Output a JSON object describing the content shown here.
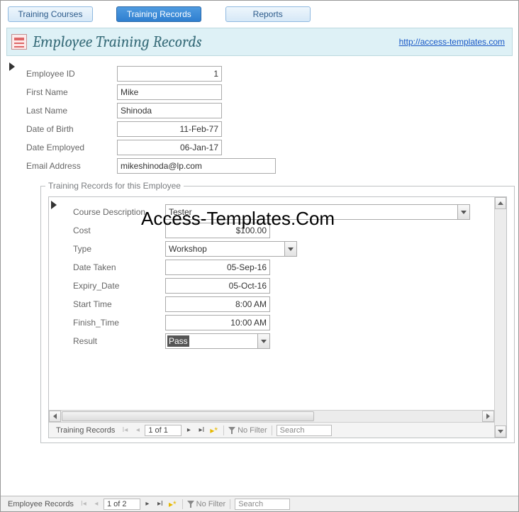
{
  "tabs": {
    "courses": "Training Courses",
    "records": "Training Records",
    "reports": "Reports"
  },
  "header": {
    "title": "Employee Training Records",
    "link": "http://access-templates.com"
  },
  "labels": {
    "emp_id": "Employee ID",
    "first_name": "First Name",
    "last_name": "Last Name",
    "dob": "Date of Birth",
    "date_employed": "Date Employed",
    "email": "Email Address",
    "sub_legend": "Training Records for this Employee",
    "course_desc": "Course Description",
    "cost": "Cost",
    "type": "Type",
    "date_taken": "Date Taken",
    "expiry": "Expiry_Date",
    "start_time": "Start Time",
    "finish_time": "Finish_Time",
    "result": "Result"
  },
  "values": {
    "emp_id": "1",
    "first_name": "Mike",
    "last_name": "Shinoda",
    "dob": "11-Feb-77",
    "date_employed": "06-Jan-17",
    "email": "mikeshinoda@lp.com",
    "course_desc": "Tester",
    "cost": "$100.00",
    "type": "Workshop",
    "date_taken": "05-Sep-16",
    "expiry": "05-Oct-16",
    "start_time": "8:00 AM",
    "finish_time": "10:00 AM",
    "result": "Pass"
  },
  "nav": {
    "sub_name": "Training Records",
    "sub_count": "1 of 1",
    "main_name": "Employee Records",
    "main_count": "1 of 2",
    "filter": "No Filter",
    "search": "Search"
  },
  "watermark": "Access-Templates.Com"
}
